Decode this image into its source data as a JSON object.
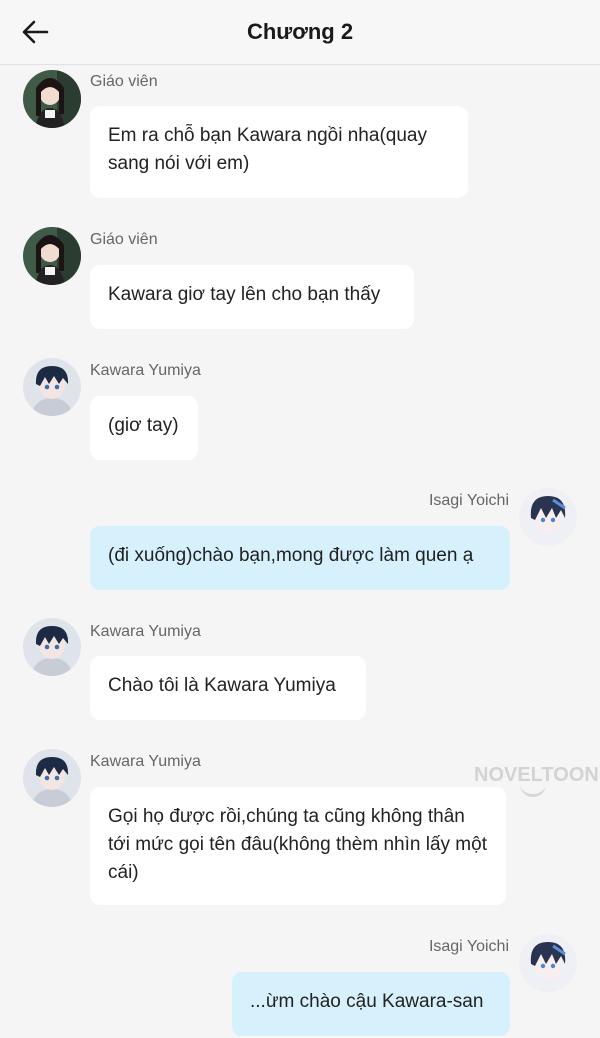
{
  "header": {
    "title": "Chương 2",
    "back_icon": "arrow-left-icon"
  },
  "messages": [
    {
      "sender": "Giáo viên",
      "side": "left",
      "avatar": "teacher-avatar",
      "text": "Em ra chỗ bạn Kawara ngồi nha(quay sang nói với em)"
    },
    {
      "sender": "Giáo viên",
      "side": "left",
      "avatar": "teacher-avatar",
      "text": "Kawara giơ tay lên cho bạn thấy"
    },
    {
      "sender": "Kawara Yumiya",
      "side": "left",
      "avatar": "kawara-avatar",
      "text": "(giơ tay)"
    },
    {
      "sender": "Isagi Yoichi",
      "side": "right",
      "avatar": "isagi-avatar",
      "text": "(đi xuống)chào bạn,mong được làm quen ạ"
    },
    {
      "sender": "Kawara Yumiya",
      "side": "left",
      "avatar": "kawara-avatar",
      "text": "Chào tôi là Kawara Yumiya"
    },
    {
      "sender": "Kawara Yumiya",
      "side": "left",
      "avatar": "kawara-avatar",
      "text": "Gọi họ được rồi,chúng ta cũng không thân tới mức gọi tên đâu(không thèm nhìn lấy một cái)"
    },
    {
      "sender": "Isagi Yoichi",
      "side": "right",
      "avatar": "isagi-avatar",
      "text": "...ừm chào cậu Kawara-san"
    }
  ],
  "watermark": {
    "text": "NOVELTOON"
  },
  "colors": {
    "left_bubble": "#ffffff",
    "right_bubble": "#d6f1fb",
    "background": "#f5f5f5"
  }
}
